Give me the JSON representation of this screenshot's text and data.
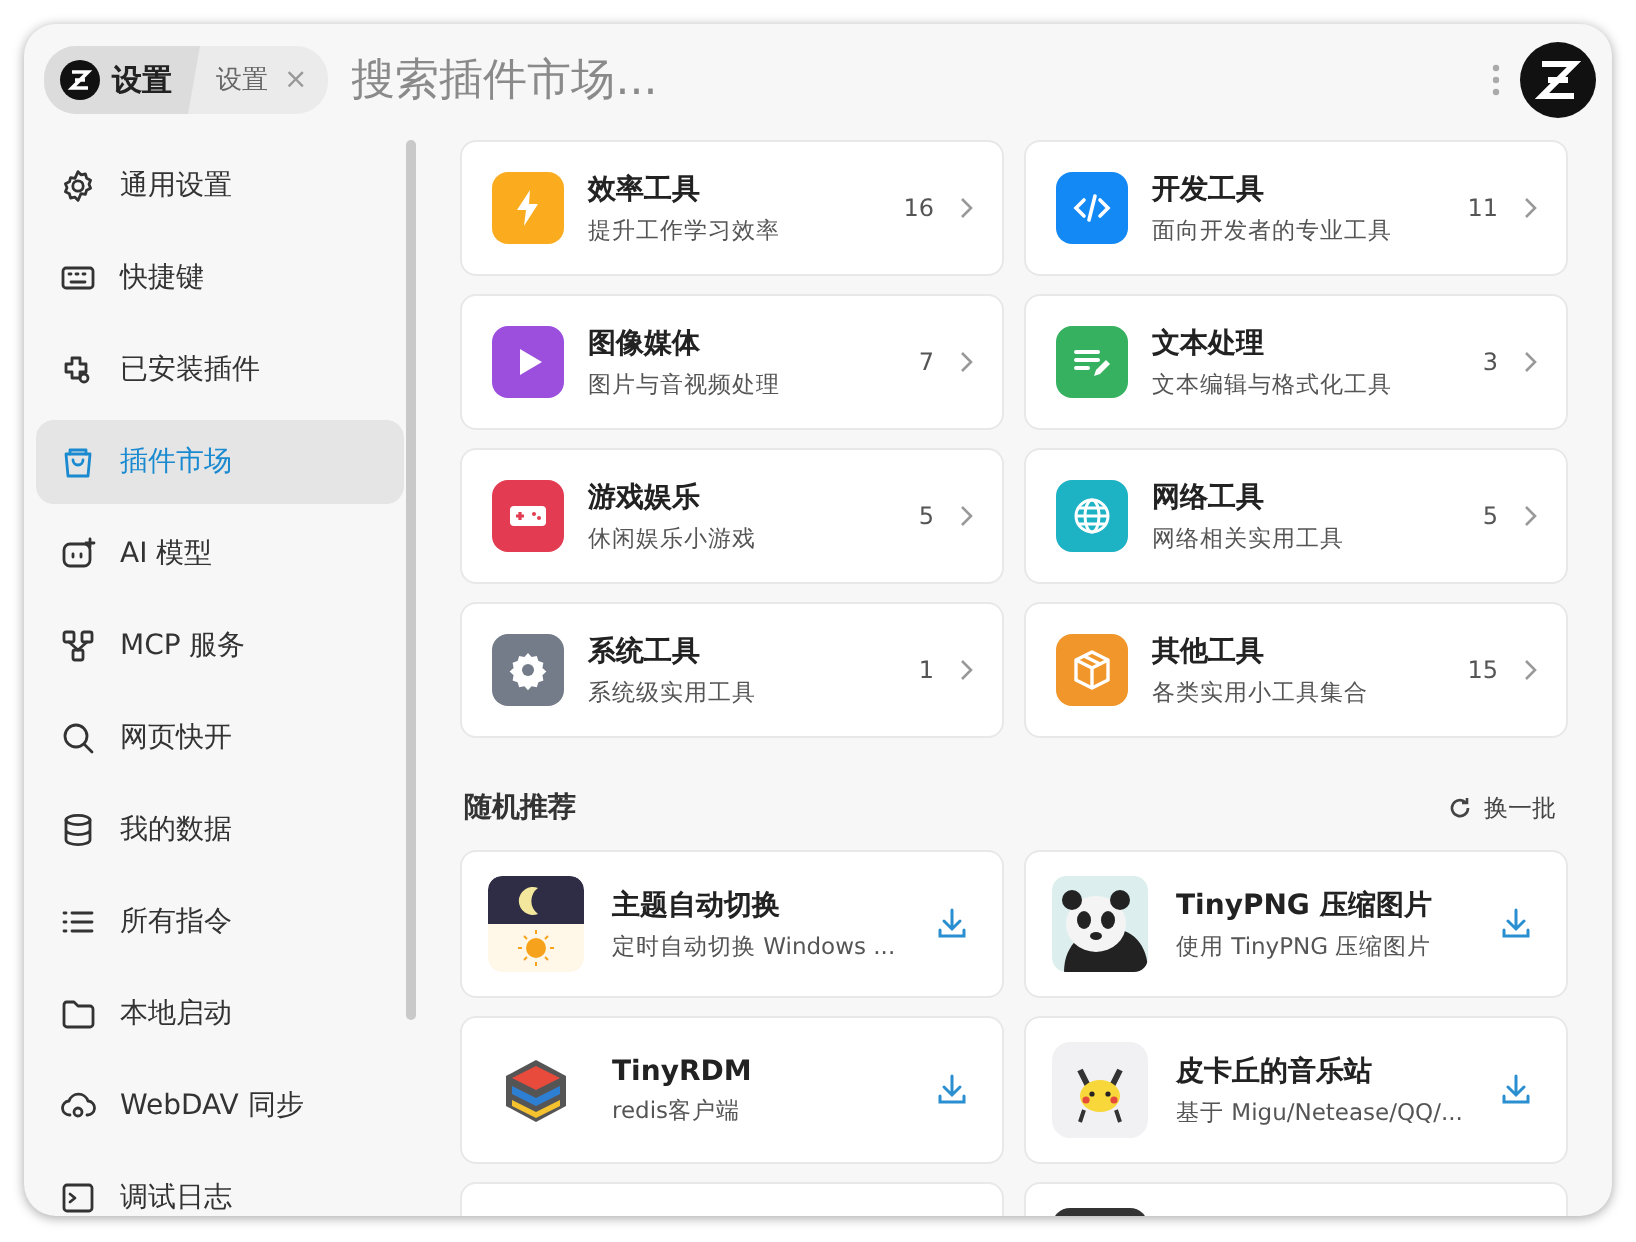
{
  "header": {
    "app_chip": {
      "label": "设置"
    },
    "tab": {
      "label": "设置",
      "close": "×"
    },
    "search": {
      "placeholder": "搜索插件市场..."
    }
  },
  "sidebar": {
    "items": [
      {
        "label": "通用设置",
        "selected": false
      },
      {
        "label": "快捷键",
        "selected": false
      },
      {
        "label": "已安装插件",
        "selected": false
      },
      {
        "label": "插件市场",
        "selected": true
      },
      {
        "label": "AI 模型",
        "selected": false
      },
      {
        "label": "MCP 服务",
        "selected": false
      },
      {
        "label": "网页快开",
        "selected": false
      },
      {
        "label": "我的数据",
        "selected": false
      },
      {
        "label": "所有指令",
        "selected": false
      },
      {
        "label": "本地启动",
        "selected": false
      },
      {
        "label": "WebDAV 同步",
        "selected": false
      },
      {
        "label": "调试日志",
        "selected": false
      }
    ]
  },
  "categories": [
    {
      "title": "效率工具",
      "subtitle": "提升工作学习效率",
      "count": "16",
      "color": "#fbab1e"
    },
    {
      "title": "开发工具",
      "subtitle": "面向开发者的专业工具",
      "count": "11",
      "color": "#1389f5"
    },
    {
      "title": "图像媒体",
      "subtitle": "图片与音视频处理",
      "count": "7",
      "color": "#9b4fdc"
    },
    {
      "title": "文本处理",
      "subtitle": "文本编辑与格式化工具",
      "count": "3",
      "color": "#36b160"
    },
    {
      "title": "游戏娱乐",
      "subtitle": "休闲娱乐小游戏",
      "count": "5",
      "color": "#e23b52"
    },
    {
      "title": "网络工具",
      "subtitle": "网络相关实用工具",
      "count": "5",
      "color": "#1db2c4"
    },
    {
      "title": "系统工具",
      "subtitle": "系统级实用工具",
      "count": "1",
      "color": "#747c89"
    },
    {
      "title": "其他工具",
      "subtitle": "各类实用小工具集合",
      "count": "15",
      "color": "#f0962a"
    }
  ],
  "recommended": {
    "title": "随机推荐",
    "refresh": "换一批",
    "items": [
      {
        "kind": "full",
        "name": "主题自动切换",
        "description": "定时自动切换 Windows ..."
      },
      {
        "kind": "full",
        "name": "TinyPNG 压缩图片",
        "description": "使用 TinyPNG 压缩图片"
      },
      {
        "kind": "full",
        "name": "TinyRDM",
        "description": "redis客户端"
      },
      {
        "kind": "full",
        "name": "皮卡丘的音乐站",
        "description": "基于 Migu/Netease/QQ/..."
      },
      {
        "kind": "cut"
      },
      {
        "kind": "cut"
      }
    ]
  }
}
